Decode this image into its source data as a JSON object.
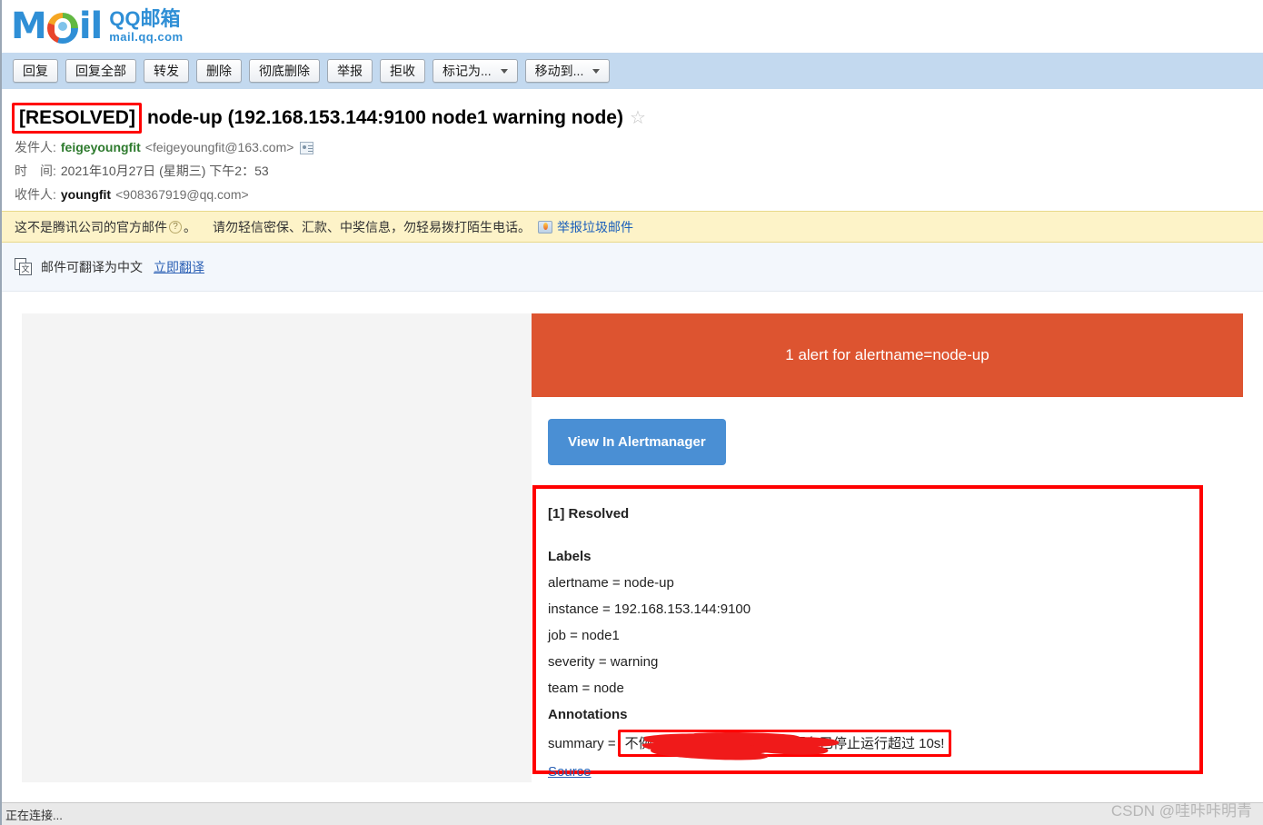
{
  "logo": {
    "brand_main": "M",
    "brand_tail": "il",
    "qq_title": "QQ邮箱",
    "qq_domain": "mail.qq.com",
    "brand_color": "#2f8fd6"
  },
  "toolbar": {
    "buttons": [
      {
        "label": "回复",
        "has_caret": false
      },
      {
        "label": "回复全部",
        "has_caret": false
      },
      {
        "label": "转发",
        "has_caret": false
      },
      {
        "label": "删除",
        "has_caret": false
      },
      {
        "label": "彻底删除",
        "has_caret": false
      },
      {
        "label": "举报",
        "has_caret": false
      },
      {
        "label": "拒收",
        "has_caret": false
      },
      {
        "label": "标记为...",
        "has_caret": true
      },
      {
        "label": "移动到...",
        "has_caret": true
      }
    ]
  },
  "mail": {
    "subject_tag": "[RESOLVED]",
    "subject_rest": "node-up (192.168.153.144:9100 node1 warning node)",
    "star_glyph": "☆",
    "from_label": "发件人:",
    "from_name": "feigeyoungfit",
    "from_addr": "<feigeyoungfit@163.com>",
    "time_label": "时　间:",
    "time_value": "2021年10月27日 (星期三) 下午2：53",
    "to_label": "收件人:",
    "to_name": "youngfit",
    "to_addr": "<908367919@qq.com>"
  },
  "warning_bar": {
    "text_before": "这不是腾讯公司的官方邮件",
    "q_mark": "?",
    "text_after": "。",
    "advice": "请勿轻信密保、汇款、中奖信息，勿轻易拨打陌生电话。",
    "report_link": "举报垃圾邮件"
  },
  "translate_bar": {
    "icon_glyph": "文",
    "text": "邮件可翻译为中文",
    "link": "立即翻译"
  },
  "alert": {
    "banner_text": "1 alert for alertname=node-up",
    "banner_color": "#dd5430",
    "button_label": "View In Alertmanager",
    "button_color": "#4a8fd4",
    "status_heading": "[1] Resolved",
    "labels_heading": "Labels",
    "labels": [
      "alertname = node-up",
      "instance = 192.168.153.144:9100",
      "job = node1",
      "severity = warning",
      "team = node"
    ],
    "annotations_heading": "Annotations",
    "summary_prefix": "summary = ",
    "summary_redacted": "不",
    "summary_text": "例192.168.153.144:9100 服务已停止运行超过 10s!",
    "source_link": "Source",
    "highlight_color": "#ff0000"
  },
  "status": {
    "text": "正在连接..."
  },
  "watermark": {
    "text": "CSDN @哇咔咔明青"
  }
}
